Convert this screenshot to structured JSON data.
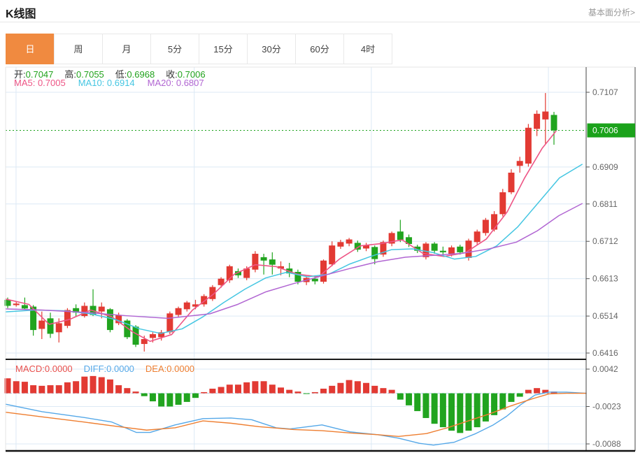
{
  "header": {
    "title": "K线图",
    "link": "基本面分析>"
  },
  "tabs": {
    "items": [
      "日",
      "周",
      "月",
      "5分",
      "15分",
      "30分",
      "60分",
      "4时"
    ],
    "active_index": 0
  },
  "ohlc": {
    "open_label": "开:",
    "open_value": "0.7047",
    "high_label": "高:",
    "high_value": "0.7055",
    "low_label": "低:",
    "low_value": "0.6968",
    "close_label": "收:",
    "close_value": "0.7006"
  },
  "ma": {
    "ma5_text": "MA5: 0.7005",
    "ma10_text": "MA10: 0.6914",
    "ma20_text": "MA20: 0.6807"
  },
  "macd_header": {
    "macd_text": "MACD:0.0000",
    "diff_text": "DIFF:0.0000",
    "dea_text": "DEA:0.0000"
  },
  "colors": {
    "up_red": "#e23a33",
    "down_green": "#21a41f",
    "ohlc_value_green": "#21a21c",
    "ma5_pink": "#ee5585",
    "ma10_cyan": "#45c6e2",
    "ma20_purple": "#b166d2",
    "macd_label_red": "#e8504d",
    "diff_blue": "#55a8e8",
    "dea_orange": "#ee7e30",
    "active_tab_bg": "#f08a40",
    "price_label_bg": "#1ba21b",
    "grid": "#dce9f5",
    "zero_line": "#aed6f2",
    "axis_text": "#666666",
    "border_dark": "#444444",
    "border_light": "#e4e4e4",
    "separator_dark": "#1a1a1a"
  },
  "chart_data": [
    {
      "type": "candlestick",
      "title": "K线图 日线",
      "grid": true,
      "ylim": [
        0.6416,
        0.7107
      ],
      "y_axis_ticks": [
        {
          "label": "0.7107",
          "value": 0.7107
        },
        {
          "label": "0.6909",
          "value": 0.6909
        },
        {
          "label": "0.6811",
          "value": 0.6811
        },
        {
          "label": "0.6712",
          "value": 0.6712
        },
        {
          "label": "0.6613",
          "value": 0.6613
        },
        {
          "label": "0.6514",
          "value": 0.6514
        },
        {
          "label": "0.6416",
          "value": 0.6416
        }
      ],
      "current_price": {
        "label": "0.7006",
        "value": 0.7006
      },
      "x_gridline_fracs": [
        0.018,
        0.325,
        0.63,
        0.935
      ],
      "candles_ohlc": [
        [
          0.6557,
          0.6563,
          0.6535,
          0.6541
        ],
        [
          0.6543,
          0.6553,
          0.6539,
          0.6547
        ],
        [
          0.6543,
          0.6563,
          0.653,
          0.6534
        ],
        [
          0.6539,
          0.6543,
          0.6462,
          0.6477
        ],
        [
          0.648,
          0.6526,
          0.6453,
          0.6502
        ],
        [
          0.6508,
          0.6523,
          0.6456,
          0.6467
        ],
        [
          0.6471,
          0.6508,
          0.6444,
          0.6495
        ],
        [
          0.6488,
          0.6535,
          0.6482,
          0.653
        ],
        [
          0.6535,
          0.6545,
          0.6512,
          0.6523
        ],
        [
          0.6514,
          0.655,
          0.651,
          0.6541
        ],
        [
          0.6541,
          0.6585,
          0.6514,
          0.6517
        ],
        [
          0.6526,
          0.655,
          0.6508,
          0.6539
        ],
        [
          0.6532,
          0.6535,
          0.6471,
          0.6477
        ],
        [
          0.6495,
          0.6523,
          0.649,
          0.6517
        ],
        [
          0.6502,
          0.6506,
          0.6453,
          0.6458
        ],
        [
          0.6486,
          0.649,
          0.6432,
          0.6438
        ],
        [
          0.644,
          0.6462,
          0.642,
          0.6453
        ],
        [
          0.6456,
          0.6471,
          0.6444,
          0.6466
        ],
        [
          0.6458,
          0.6477,
          0.6449,
          0.6471
        ],
        [
          0.6471,
          0.6526,
          0.6466,
          0.6521
        ],
        [
          0.6517,
          0.6539,
          0.651,
          0.6535
        ],
        [
          0.6532,
          0.6554,
          0.6526,
          0.655
        ],
        [
          0.6539,
          0.6557,
          0.6532,
          0.6545
        ],
        [
          0.6545,
          0.6572,
          0.6539,
          0.6567
        ],
        [
          0.6559,
          0.6596,
          0.6554,
          0.6591
        ],
        [
          0.6596,
          0.6617,
          0.6589,
          0.6613
        ],
        [
          0.6609,
          0.665,
          0.6602,
          0.6646
        ],
        [
          0.6633,
          0.664,
          0.6615,
          0.6622
        ],
        [
          0.6615,
          0.6646,
          0.6609,
          0.664
        ],
        [
          0.6637,
          0.6686,
          0.663,
          0.6679
        ],
        [
          0.667,
          0.6679,
          0.6624,
          0.6661
        ],
        [
          0.6664,
          0.6683,
          0.6624,
          0.665
        ],
        [
          0.664,
          0.6659,
          0.6622,
          0.6646
        ],
        [
          0.664,
          0.6655,
          0.6617,
          0.6627
        ],
        [
          0.6631,
          0.6637,
          0.6598,
          0.6605
        ],
        [
          0.6604,
          0.662,
          0.6596,
          0.6615
        ],
        [
          0.6613,
          0.6622,
          0.6598,
          0.6606
        ],
        [
          0.6605,
          0.6664,
          0.66,
          0.6661
        ],
        [
          0.6651,
          0.6712,
          0.6646,
          0.6701
        ],
        [
          0.6698,
          0.6716,
          0.6692,
          0.671
        ],
        [
          0.6706,
          0.6721,
          0.6699,
          0.6717
        ],
        [
          0.6708,
          0.6714,
          0.6684,
          0.669
        ],
        [
          0.6693,
          0.6708,
          0.6686,
          0.6702
        ],
        [
          0.6697,
          0.6701,
          0.6651,
          0.6665
        ],
        [
          0.6677,
          0.6714,
          0.6671,
          0.671
        ],
        [
          0.6706,
          0.6738,
          0.6699,
          0.6734
        ],
        [
          0.6738,
          0.6769,
          0.671,
          0.6716
        ],
        [
          0.6723,
          0.673,
          0.6697,
          0.6705
        ],
        [
          0.6698,
          0.6703,
          0.6681,
          0.6687
        ],
        [
          0.667,
          0.671,
          0.6664,
          0.6706
        ],
        [
          0.6706,
          0.671,
          0.6679,
          0.6687
        ],
        [
          0.6687,
          0.6698,
          0.6674,
          0.6683
        ],
        [
          0.6679,
          0.6701,
          0.6672,
          0.6696
        ],
        [
          0.6698,
          0.6703,
          0.6677,
          0.6683
        ],
        [
          0.6668,
          0.6719,
          0.6661,
          0.6714
        ],
        [
          0.671,
          0.6743,
          0.6703,
          0.6738
        ],
        [
          0.6734,
          0.6774,
          0.6727,
          0.6769
        ],
        [
          0.6743,
          0.6792,
          0.6738,
          0.6784
        ],
        [
          0.6784,
          0.6851,
          0.6778,
          0.6842
        ],
        [
          0.6842,
          0.6903,
          0.6837,
          0.6894
        ],
        [
          0.6912,
          0.6936,
          0.6894,
          0.6925
        ],
        [
          0.6918,
          0.7023,
          0.691,
          0.7013
        ],
        [
          0.701,
          0.7059,
          0.6991,
          0.705
        ],
        [
          0.7035,
          0.7105,
          0.6971,
          0.7056
        ],
        [
          0.7047,
          0.7055,
          0.6968,
          0.7006
        ]
      ],
      "ma5_line": [
        [
          0,
          0.6559
        ],
        [
          0.04,
          0.6545
        ],
        [
          0.075,
          0.6492
        ],
        [
          0.11,
          0.6505
        ],
        [
          0.147,
          0.653
        ],
        [
          0.183,
          0.6512
        ],
        [
          0.219,
          0.6472
        ],
        [
          0.249,
          0.6447
        ],
        [
          0.286,
          0.6465
        ],
        [
          0.322,
          0.653
        ],
        [
          0.358,
          0.6572
        ],
        [
          0.394,
          0.6625
        ],
        [
          0.43,
          0.665
        ],
        [
          0.466,
          0.6645
        ],
        [
          0.502,
          0.6625
        ],
        [
          0.539,
          0.6618
        ],
        [
          0.575,
          0.6665
        ],
        [
          0.611,
          0.67
        ],
        [
          0.647,
          0.6706
        ],
        [
          0.683,
          0.6716
        ],
        [
          0.719,
          0.668
        ],
        [
          0.755,
          0.6672
        ],
        [
          0.792,
          0.6682
        ],
        [
          0.828,
          0.6718
        ],
        [
          0.864,
          0.679
        ],
        [
          0.894,
          0.688
        ],
        [
          0.924,
          0.6958
        ],
        [
          0.948,
          0.7004
        ]
      ],
      "ma10_line": [
        [
          0,
          0.6525
        ],
        [
          0.051,
          0.653
        ],
        [
          0.099,
          0.6528
        ],
        [
          0.147,
          0.652
        ],
        [
          0.189,
          0.6505
        ],
        [
          0.231,
          0.648
        ],
        [
          0.267,
          0.6468
        ],
        [
          0.304,
          0.648
        ],
        [
          0.34,
          0.6512
        ],
        [
          0.376,
          0.655
        ],
        [
          0.412,
          0.6585
        ],
        [
          0.448,
          0.6615
        ],
        [
          0.484,
          0.663
        ],
        [
          0.52,
          0.6618
        ],
        [
          0.557,
          0.6625
        ],
        [
          0.593,
          0.6652
        ],
        [
          0.629,
          0.6672
        ],
        [
          0.665,
          0.669
        ],
        [
          0.701,
          0.6692
        ],
        [
          0.737,
          0.6682
        ],
        [
          0.773,
          0.6665
        ],
        [
          0.81,
          0.6672
        ],
        [
          0.846,
          0.67
        ],
        [
          0.882,
          0.675
        ],
        [
          0.918,
          0.6815
        ],
        [
          0.954,
          0.688
        ],
        [
          0.993,
          0.6916
        ]
      ],
      "ma20_line": [
        [
          0,
          0.6533
        ],
        [
          0.063,
          0.653
        ],
        [
          0.135,
          0.6524
        ],
        [
          0.207,
          0.6515
        ],
        [
          0.28,
          0.6508
        ],
        [
          0.352,
          0.652
        ],
        [
          0.4,
          0.6545
        ],
        [
          0.448,
          0.6578
        ],
        [
          0.496,
          0.66
        ],
        [
          0.544,
          0.662
        ],
        [
          0.593,
          0.664
        ],
        [
          0.641,
          0.6658
        ],
        [
          0.689,
          0.667
        ],
        [
          0.737,
          0.6675
        ],
        [
          0.785,
          0.668
        ],
        [
          0.833,
          0.6692
        ],
        [
          0.88,
          0.671
        ],
        [
          0.916,
          0.674
        ],
        [
          0.953,
          0.678
        ],
        [
          0.993,
          0.6812
        ]
      ]
    },
    {
      "type": "bar",
      "name": "MACD",
      "ylim": [
        -0.0088,
        0.0042
      ],
      "y_axis_ticks": [
        {
          "label": "0.0042",
          "value": 0.0042
        },
        {
          "label": "-0.0023",
          "value": -0.0023
        },
        {
          "label": "-0.0088",
          "value": -0.0088
        }
      ],
      "zero_line": 0,
      "values": [
        0.0026,
        0.0021,
        0.002,
        0.0014,
        0.0013,
        0.0014,
        0.0014,
        0.0019,
        0.0021,
        0.0029,
        0.003,
        0.0028,
        0.0024,
        0.0014,
        0.0009,
        0.0003,
        -0.0005,
        -0.0014,
        -0.0023,
        -0.0023,
        -0.002,
        -0.0015,
        -0.0008,
        0.0002,
        0.0008,
        0.0011,
        0.0015,
        0.0015,
        0.0019,
        0.0021,
        0.0021,
        0.0015,
        0.001,
        0.0006,
        0.0003,
        -0.0001,
        0.0002,
        0.0008,
        0.0013,
        0.0018,
        0.0023,
        0.0021,
        0.0018,
        0.0013,
        0.0009,
        0.0006,
        -0.0011,
        -0.0021,
        -0.0031,
        -0.0043,
        -0.0053,
        -0.0059,
        -0.0065,
        -0.0069,
        -0.0065,
        -0.0059,
        -0.0049,
        -0.0038,
        -0.0028,
        -0.0015,
        -0.0006,
        0.0006,
        0.0009,
        0.0006,
        0.0003
      ],
      "diff_line": [
        [
          0,
          -0.0019
        ],
        [
          0.063,
          -0.0032
        ],
        [
          0.135,
          -0.0042
        ],
        [
          0.183,
          -0.005
        ],
        [
          0.225,
          -0.0068
        ],
        [
          0.249,
          -0.0068
        ],
        [
          0.292,
          -0.0055
        ],
        [
          0.34,
          -0.0044
        ],
        [
          0.388,
          -0.0043
        ],
        [
          0.424,
          -0.0046
        ],
        [
          0.466,
          -0.006
        ],
        [
          0.49,
          -0.0062
        ],
        [
          0.545,
          -0.0055
        ],
        [
          0.593,
          -0.0067
        ],
        [
          0.641,
          -0.0072
        ],
        [
          0.677,
          -0.0078
        ],
        [
          0.713,
          -0.0087
        ],
        [
          0.737,
          -0.009
        ],
        [
          0.773,
          -0.0085
        ],
        [
          0.81,
          -0.007
        ],
        [
          0.84,
          -0.0055
        ],
        [
          0.863,
          -0.004
        ],
        [
          0.887,
          -0.002
        ],
        [
          0.912,
          -0.0003
        ],
        [
          0.936,
          0.0002
        ],
        [
          0.966,
          0.0002
        ],
        [
          1,
          0.0
        ]
      ],
      "dea_line": [
        [
          0,
          -0.0033
        ],
        [
          0.063,
          -0.0041
        ],
        [
          0.135,
          -0.005
        ],
        [
          0.195,
          -0.0058
        ],
        [
          0.243,
          -0.0064
        ],
        [
          0.292,
          -0.006
        ],
        [
          0.34,
          -0.0048
        ],
        [
          0.388,
          -0.0052
        ],
        [
          0.436,
          -0.0058
        ],
        [
          0.496,
          -0.0063
        ],
        [
          0.545,
          -0.0065
        ],
        [
          0.593,
          -0.0069
        ],
        [
          0.641,
          -0.0072
        ],
        [
          0.677,
          -0.0075
        ],
        [
          0.725,
          -0.007
        ],
        [
          0.761,
          -0.006
        ],
        [
          0.797,
          -0.0048
        ],
        [
          0.833,
          -0.0036
        ],
        [
          0.87,
          -0.0022
        ],
        [
          0.906,
          -0.001
        ],
        [
          0.936,
          -0.0001
        ],
        [
          0.966,
          0.0
        ],
        [
          1,
          0.0
        ]
      ]
    }
  ]
}
